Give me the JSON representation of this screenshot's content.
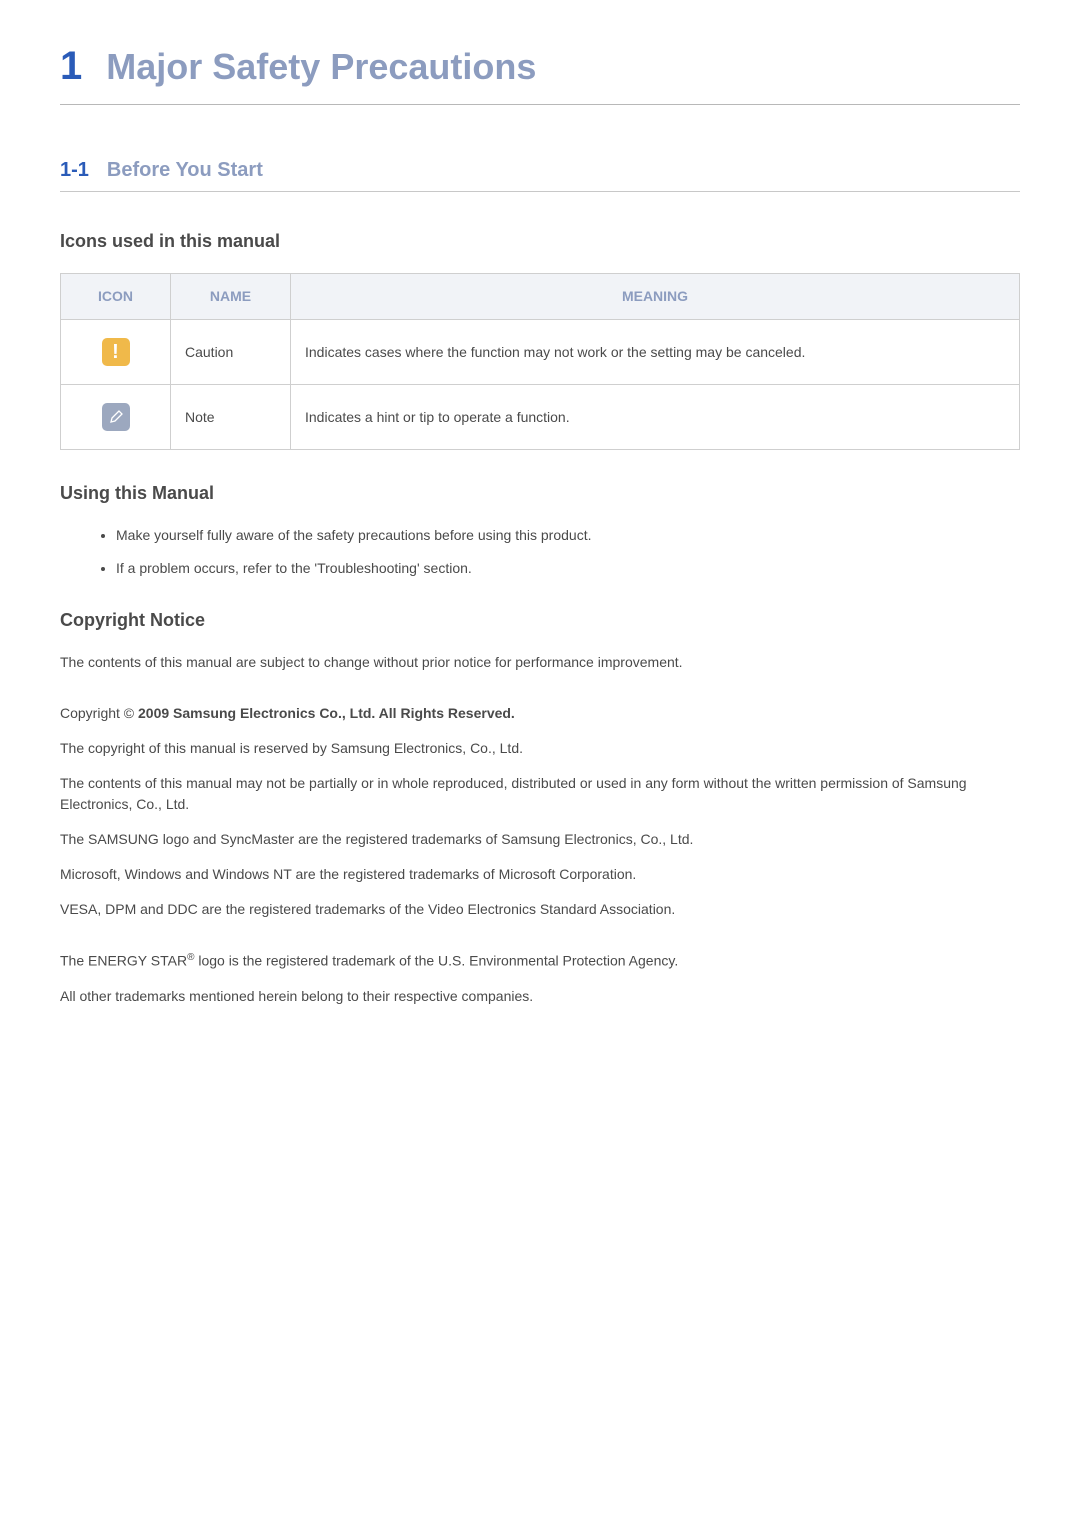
{
  "chapter": {
    "number": "1",
    "title": "Major Safety Precautions"
  },
  "section": {
    "number": "1-1",
    "title": "Before You Start"
  },
  "icons_heading": "Icons used in this manual",
  "icons_table": {
    "headers": [
      "ICON",
      "NAME",
      "MEANING"
    ],
    "rows": [
      {
        "icon": "caution-icon",
        "name": "Caution",
        "meaning": "Indicates cases where the function may not work or the setting may be canceled."
      },
      {
        "icon": "note-icon",
        "name": "Note",
        "meaning": "Indicates a hint or tip to operate a function."
      }
    ]
  },
  "using_manual": {
    "heading": "Using this Manual",
    "bullets": [
      "Make yourself fully aware of the safety precautions before using this product.",
      "If a problem occurs, refer to the 'Troubleshooting' section."
    ]
  },
  "copyright": {
    "heading": "Copyright Notice",
    "intro": "The contents of this manual are subject to change without prior notice for performance improvement.",
    "copyright_prefix": "Copyright © ",
    "copyright_bold": "2009 Samsung Electronics Co., Ltd. All Rights Reserved.",
    "paragraphs": [
      "The copyright of this manual is reserved by Samsung Electronics, Co., Ltd.",
      "The contents of this manual may not be partially or in whole reproduced, distributed or used in any form without the written permission of Samsung Electronics, Co., Ltd.",
      "The SAMSUNG logo and SyncMaster are the registered trademarks of Samsung Electronics, Co., Ltd.",
      "Microsoft, Windows and Windows NT are the registered trademarks of Microsoft Corporation.",
      "VESA, DPM and DDC are the registered trademarks of the Video Electronics Standard Association."
    ],
    "energy_star_pre": "The ENERGY STAR",
    "energy_star_sup": "®",
    "energy_star_post": " logo is the registered trademark of the U.S. Environmental Protection Agency.",
    "final": "All other trademarks mentioned herein belong to their respective companies."
  }
}
